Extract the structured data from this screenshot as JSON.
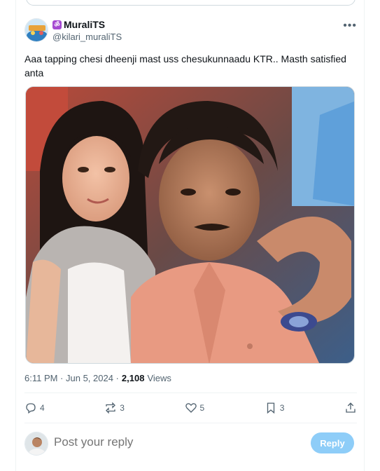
{
  "tweet": {
    "display_name": "MuraliTS",
    "badge_glyph": "ॐ",
    "handle": "@kilari_muraliTS",
    "more_glyph": "•••",
    "text": "Aaa tapping chesi dheenji mast uss chesukunnaadu KTR.. Masth satisfied anta",
    "media_icon": "photo-two-people",
    "time": "6:11 PM · Jun 5, 2024 ·",
    "views_count": "2,108",
    "views_label": "Views"
  },
  "actions": {
    "replies": "4",
    "reposts": "3",
    "likes": "5",
    "bookmarks": "3"
  },
  "composer": {
    "placeholder": "Post your reply",
    "button_label": "Reply"
  },
  "colors": {
    "accent_disabled": "#8ecdf8",
    "secondary_text": "#536471",
    "badge_purple": "#a54ad1"
  }
}
